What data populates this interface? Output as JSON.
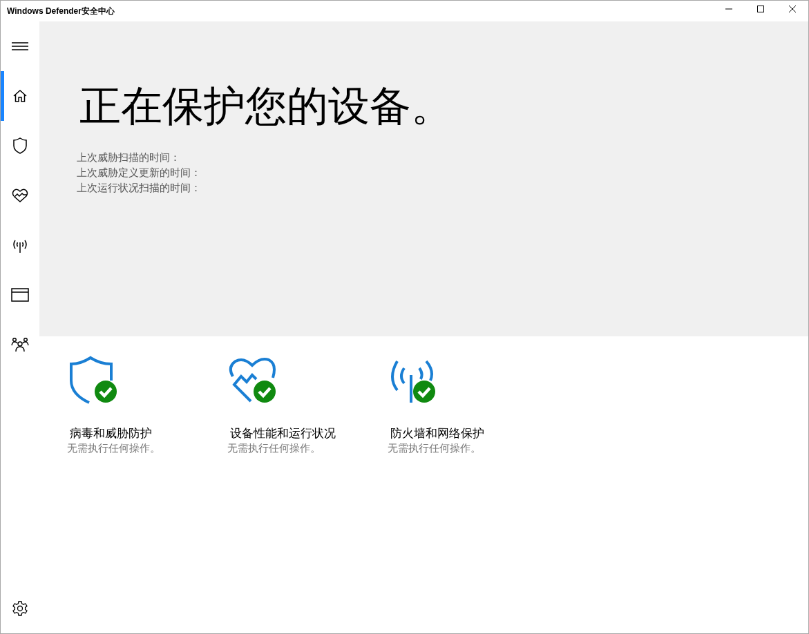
{
  "window": {
    "title": "Windows Defender安全中心"
  },
  "nav": [
    {
      "kind": "home",
      "selected": true
    },
    {
      "kind": "shield",
      "selected": false
    },
    {
      "kind": "heart",
      "selected": false
    },
    {
      "kind": "antenna",
      "selected": false
    },
    {
      "kind": "browser",
      "selected": false
    },
    {
      "kind": "family",
      "selected": false
    }
  ],
  "hero": {
    "heading": "正在保护您的设备。",
    "lines": [
      "上次威胁扫描的时间：",
      "上次威胁定义更新的时间：",
      "上次运行状况扫描的时间："
    ]
  },
  "tiles": [
    {
      "kind": "shield",
      "title": "病毒和威胁防护",
      "status": "无需执行任何操作。"
    },
    {
      "kind": "heart",
      "title": "设备性能和运行状况",
      "status": "无需执行任何操作。"
    },
    {
      "kind": "antenna",
      "title": "防火墙和网络保护",
      "status": "无需执行任何操作。"
    }
  ]
}
